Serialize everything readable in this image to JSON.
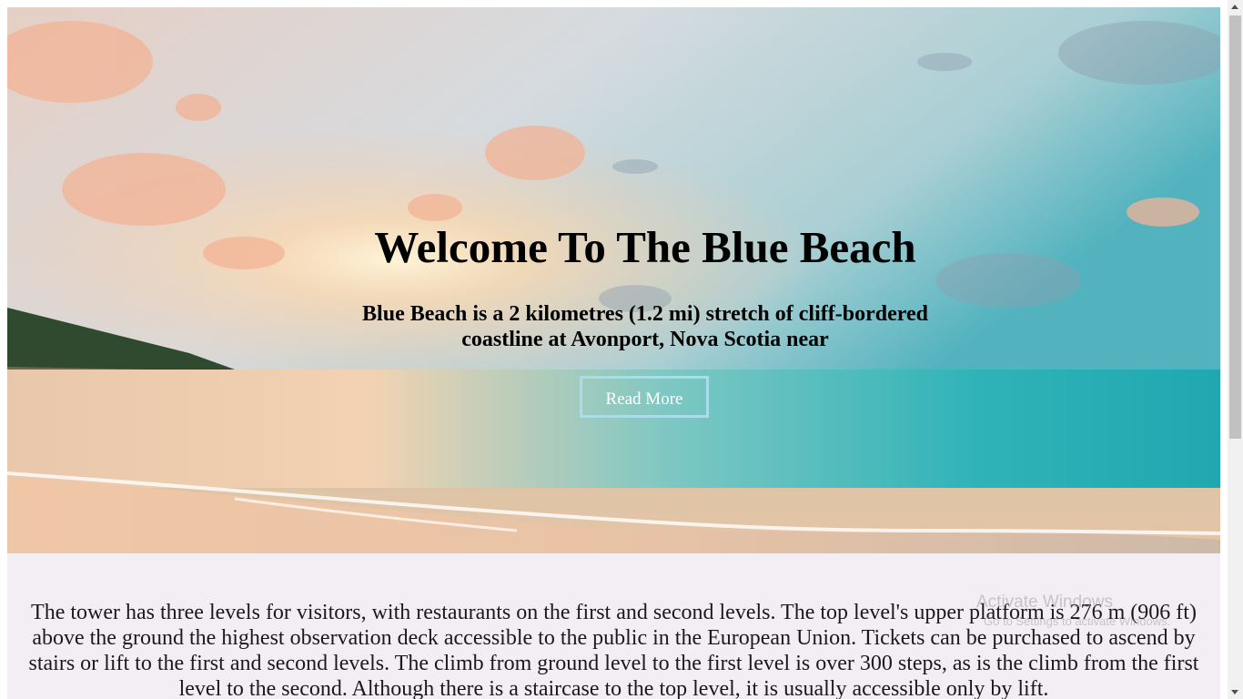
{
  "hero": {
    "title": "Welcome To The Blue Beach",
    "subtitle": "Blue Beach is a 2 kilometres (1.2 mi) stretch of cliff-bordered coastline at Avonport, Nova Scotia near",
    "button_label": "Read More"
  },
  "content": {
    "paragraph": "The tower has three levels for visitors, with restaurants on the first and second levels. The top level's upper platform is 276 m (906 ft) above the ground the highest observation deck accessible to the public in the European Union. Tickets can be purchased to ascend by stairs or lift to the first and second levels. The climb from ground level to the first level is over 300 steps, as is the climb from the first level to the second. Although there is a staircase to the top level, it is usually accessible only by lift."
  },
  "watermark": {
    "line1": "Activate Windows",
    "line2": "Go to Settings to activate Windows."
  },
  "colors": {
    "button_border": "#a8dde9",
    "content_bg": "#f3eef4",
    "sea": "#3fb8bd"
  }
}
